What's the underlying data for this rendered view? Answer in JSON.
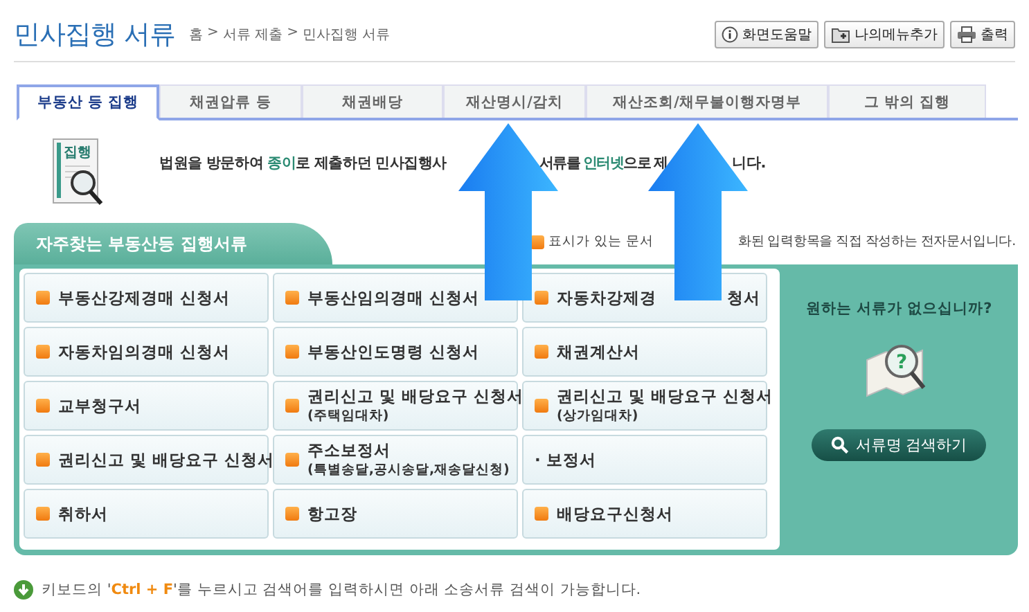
{
  "page_title": "민사집행 서류",
  "breadcrumb": [
    "홈",
    ">",
    "서류 제출",
    ">",
    "민사집행 서류"
  ],
  "header_buttons": [
    {
      "kind": "help",
      "label": "화면도움말"
    },
    {
      "kind": "bookmark",
      "label": "나의메뉴추가"
    },
    {
      "kind": "print",
      "label": "출력"
    }
  ],
  "tabs": [
    {
      "label": "부동산 등 집행",
      "selected": true
    },
    {
      "label": "채권압류 등",
      "selected": false
    },
    {
      "label": "채권배당",
      "selected": false
    },
    {
      "label": "재산명시/감치",
      "selected": false
    },
    {
      "label": "재산조회/채무불이행자명부",
      "selected": false
    },
    {
      "label": "그 밖의 집행",
      "selected": false
    }
  ],
  "intro": {
    "icon_label": "집행",
    "fragments": [
      [
        {
          "text": "법원을 방문하여 ",
          "highlight": false
        },
        {
          "text": "종이",
          "highlight": true
        },
        {
          "text": "로 제출하던 민사집행사",
          "highlight": false
        }
      ],
      [
        {
          "text": "서류를 ",
          "highlight": false
        },
        {
          "text": "인터넷",
          "highlight": true
        },
        {
          "text": "으로 제",
          "highlight": false
        }
      ],
      [
        {
          "text": "니다.",
          "highlight": false
        }
      ]
    ]
  },
  "panel": {
    "title": "자주찾는 부동산등 집행서류",
    "legend": [
      "표시가 있는 문서",
      "화된 입력항목을 직접 작성하는 전자문서입니다."
    ],
    "items": [
      {
        "kind": "e",
        "parts": [
          "부동산강제경매 신청서"
        ]
      },
      {
        "kind": "e",
        "parts": [
          "부동산임의경매 신청서"
        ]
      },
      {
        "kind": "e",
        "parts": [
          "자동차강제경",
          "청서"
        ]
      },
      {
        "kind": "e",
        "parts": [
          "자동차임의경매 신청서"
        ]
      },
      {
        "kind": "e",
        "parts": [
          "부동산인도명령 신청서"
        ]
      },
      {
        "kind": "e",
        "parts": [
          "채권계산서"
        ]
      },
      {
        "kind": "e",
        "parts": [
          "교부청구서"
        ]
      },
      {
        "kind": "e",
        "parts": [
          "권리신고 및 배당요구 신청서"
        ],
        "subtitle": "(주택임대차)"
      },
      {
        "kind": "e",
        "parts": [
          "권리신고 및 배당요구 신청서"
        ],
        "subtitle": "(상가임대차)"
      },
      {
        "kind": "e",
        "parts": [
          "권리신고 및 배당요구 신청서"
        ]
      },
      {
        "kind": "e",
        "parts": [
          "주소보정서"
        ],
        "subtitle": "(특별송달,공시송달,재송달신청)"
      },
      {
        "kind": "plain",
        "parts": [
          "· 보정서"
        ]
      },
      {
        "kind": "e",
        "parts": [
          "취하서"
        ]
      },
      {
        "kind": "e",
        "parts": [
          "항고장"
        ]
      },
      {
        "kind": "e",
        "parts": [
          "배당요구신청서"
        ]
      }
    ],
    "side": {
      "question": "원하는 서류가 없으십니까?",
      "icon_mark": "?",
      "search_button": "서류명 검색하기"
    }
  },
  "footer": "키보드의 '**Ctrl + F**'를 누르시고 검색어를 입력하시면 아래 소송서류 검색이 가능합니다."
}
